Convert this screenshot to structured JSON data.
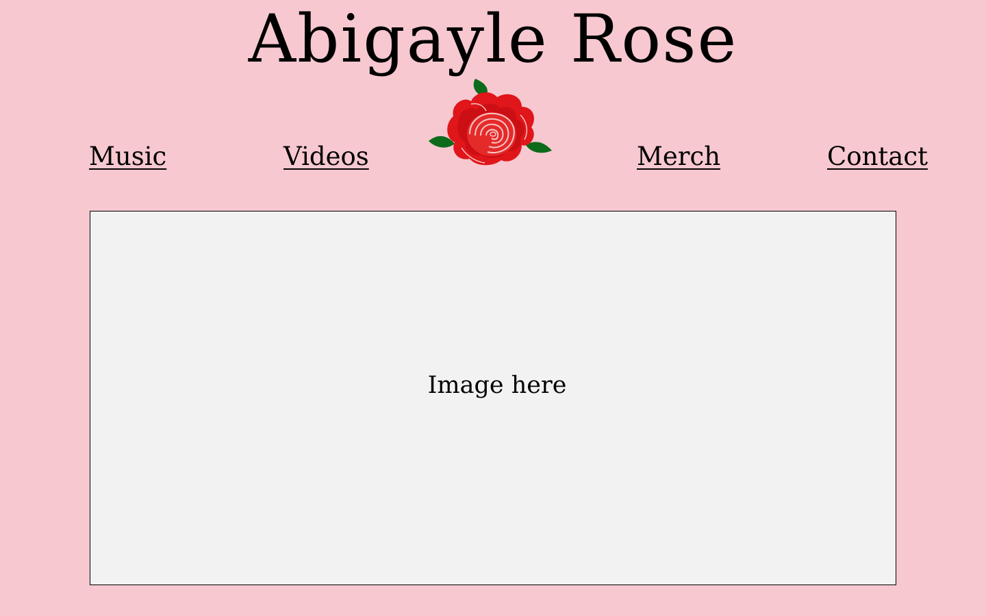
{
  "header": {
    "title": "Abigayle Rose"
  },
  "nav": {
    "items": [
      {
        "label": "Music"
      },
      {
        "label": "Videos"
      },
      {
        "label": "Merch"
      },
      {
        "label": "Contact"
      }
    ],
    "logo_icon": "rose-icon"
  },
  "main": {
    "image_placeholder_label": "Image here"
  },
  "colors": {
    "background": "#f7c8d0",
    "placeholder_fill": "#f2f2f2",
    "rose_red": "#e0161a",
    "leaf_green": "#0e6b1c"
  }
}
